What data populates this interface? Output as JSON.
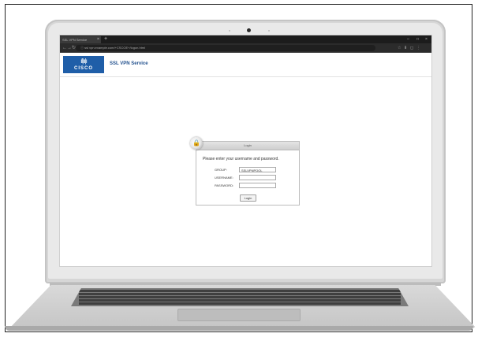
{
  "browser": {
    "tab_title": "SSL VPN Service",
    "tab_close": "×",
    "new_tab": "+",
    "window_controls": [
      "–",
      "□",
      "×"
    ],
    "nav_icons": [
      "←",
      "→",
      "↻"
    ],
    "url": "ⓘ ssl vpn.example.com/+CSCOE+/logon.html",
    "extension_icons": [
      "☆",
      "⬇",
      "◻",
      "⋮"
    ]
  },
  "header": {
    "logo_bars": "ıl|ıı|ı",
    "logo_text": "CISCO",
    "service_title": "SSL VPN Service"
  },
  "login": {
    "panel_title": "Login",
    "prompt": "Please enter your username and password.",
    "fields": [
      {
        "label": "GROUP:",
        "value": "SSLVPNPOOL"
      },
      {
        "label": "USERNAME:",
        "value": ""
      },
      {
        "label": "PASSWORD:",
        "value": ""
      }
    ],
    "button_label": "Login"
  },
  "colors": {
    "logo_background": "#1f5ea8",
    "title_blue": "#1f4e8c",
    "browser_chrome": "#2b2b2b"
  }
}
